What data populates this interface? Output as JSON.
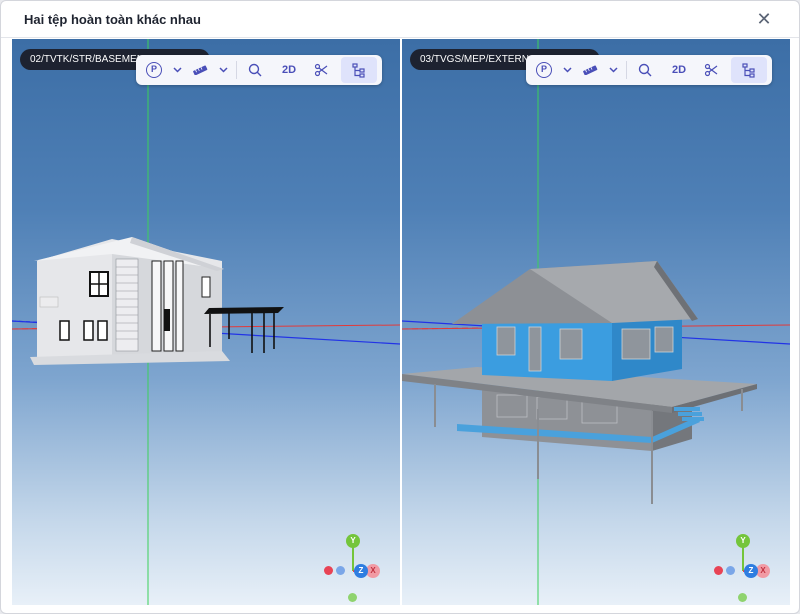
{
  "dialog": {
    "title": "Hai tệp hoàn toàn khác nhau",
    "close_icon": "close-icon"
  },
  "viewers": [
    {
      "file_name": "02/TVTK/STR/BASEMENT",
      "toolbar": {
        "projection_label": "P",
        "view_2d_label": "2D",
        "icons": [
          "projection-icon",
          "chevron-down-icon",
          "ruler-icon",
          "chevron-down-icon",
          "zoom-icon",
          "scissors-icon",
          "model-tree-icon"
        ]
      },
      "gizmo": {
        "y": "Y",
        "z": "Z",
        "x": "X"
      }
    },
    {
      "file_name": "03/TVGS/MEP/EXTERNAL",
      "toolbar": {
        "projection_label": "P",
        "view_2d_label": "2D",
        "icons": [
          "projection-icon",
          "chevron-down-icon",
          "ruler-icon",
          "chevron-down-icon",
          "zoom-icon",
          "scissors-icon",
          "model-tree-icon"
        ]
      },
      "gizmo": {
        "y": "Y",
        "z": "Z",
        "x": "X"
      }
    }
  ],
  "colors": {
    "accent": "#4a4fb8",
    "axis_x": "#e84355",
    "axis_y": "#74c53b",
    "axis_z": "#2f7de0",
    "pill_bg": "#1d2230"
  }
}
